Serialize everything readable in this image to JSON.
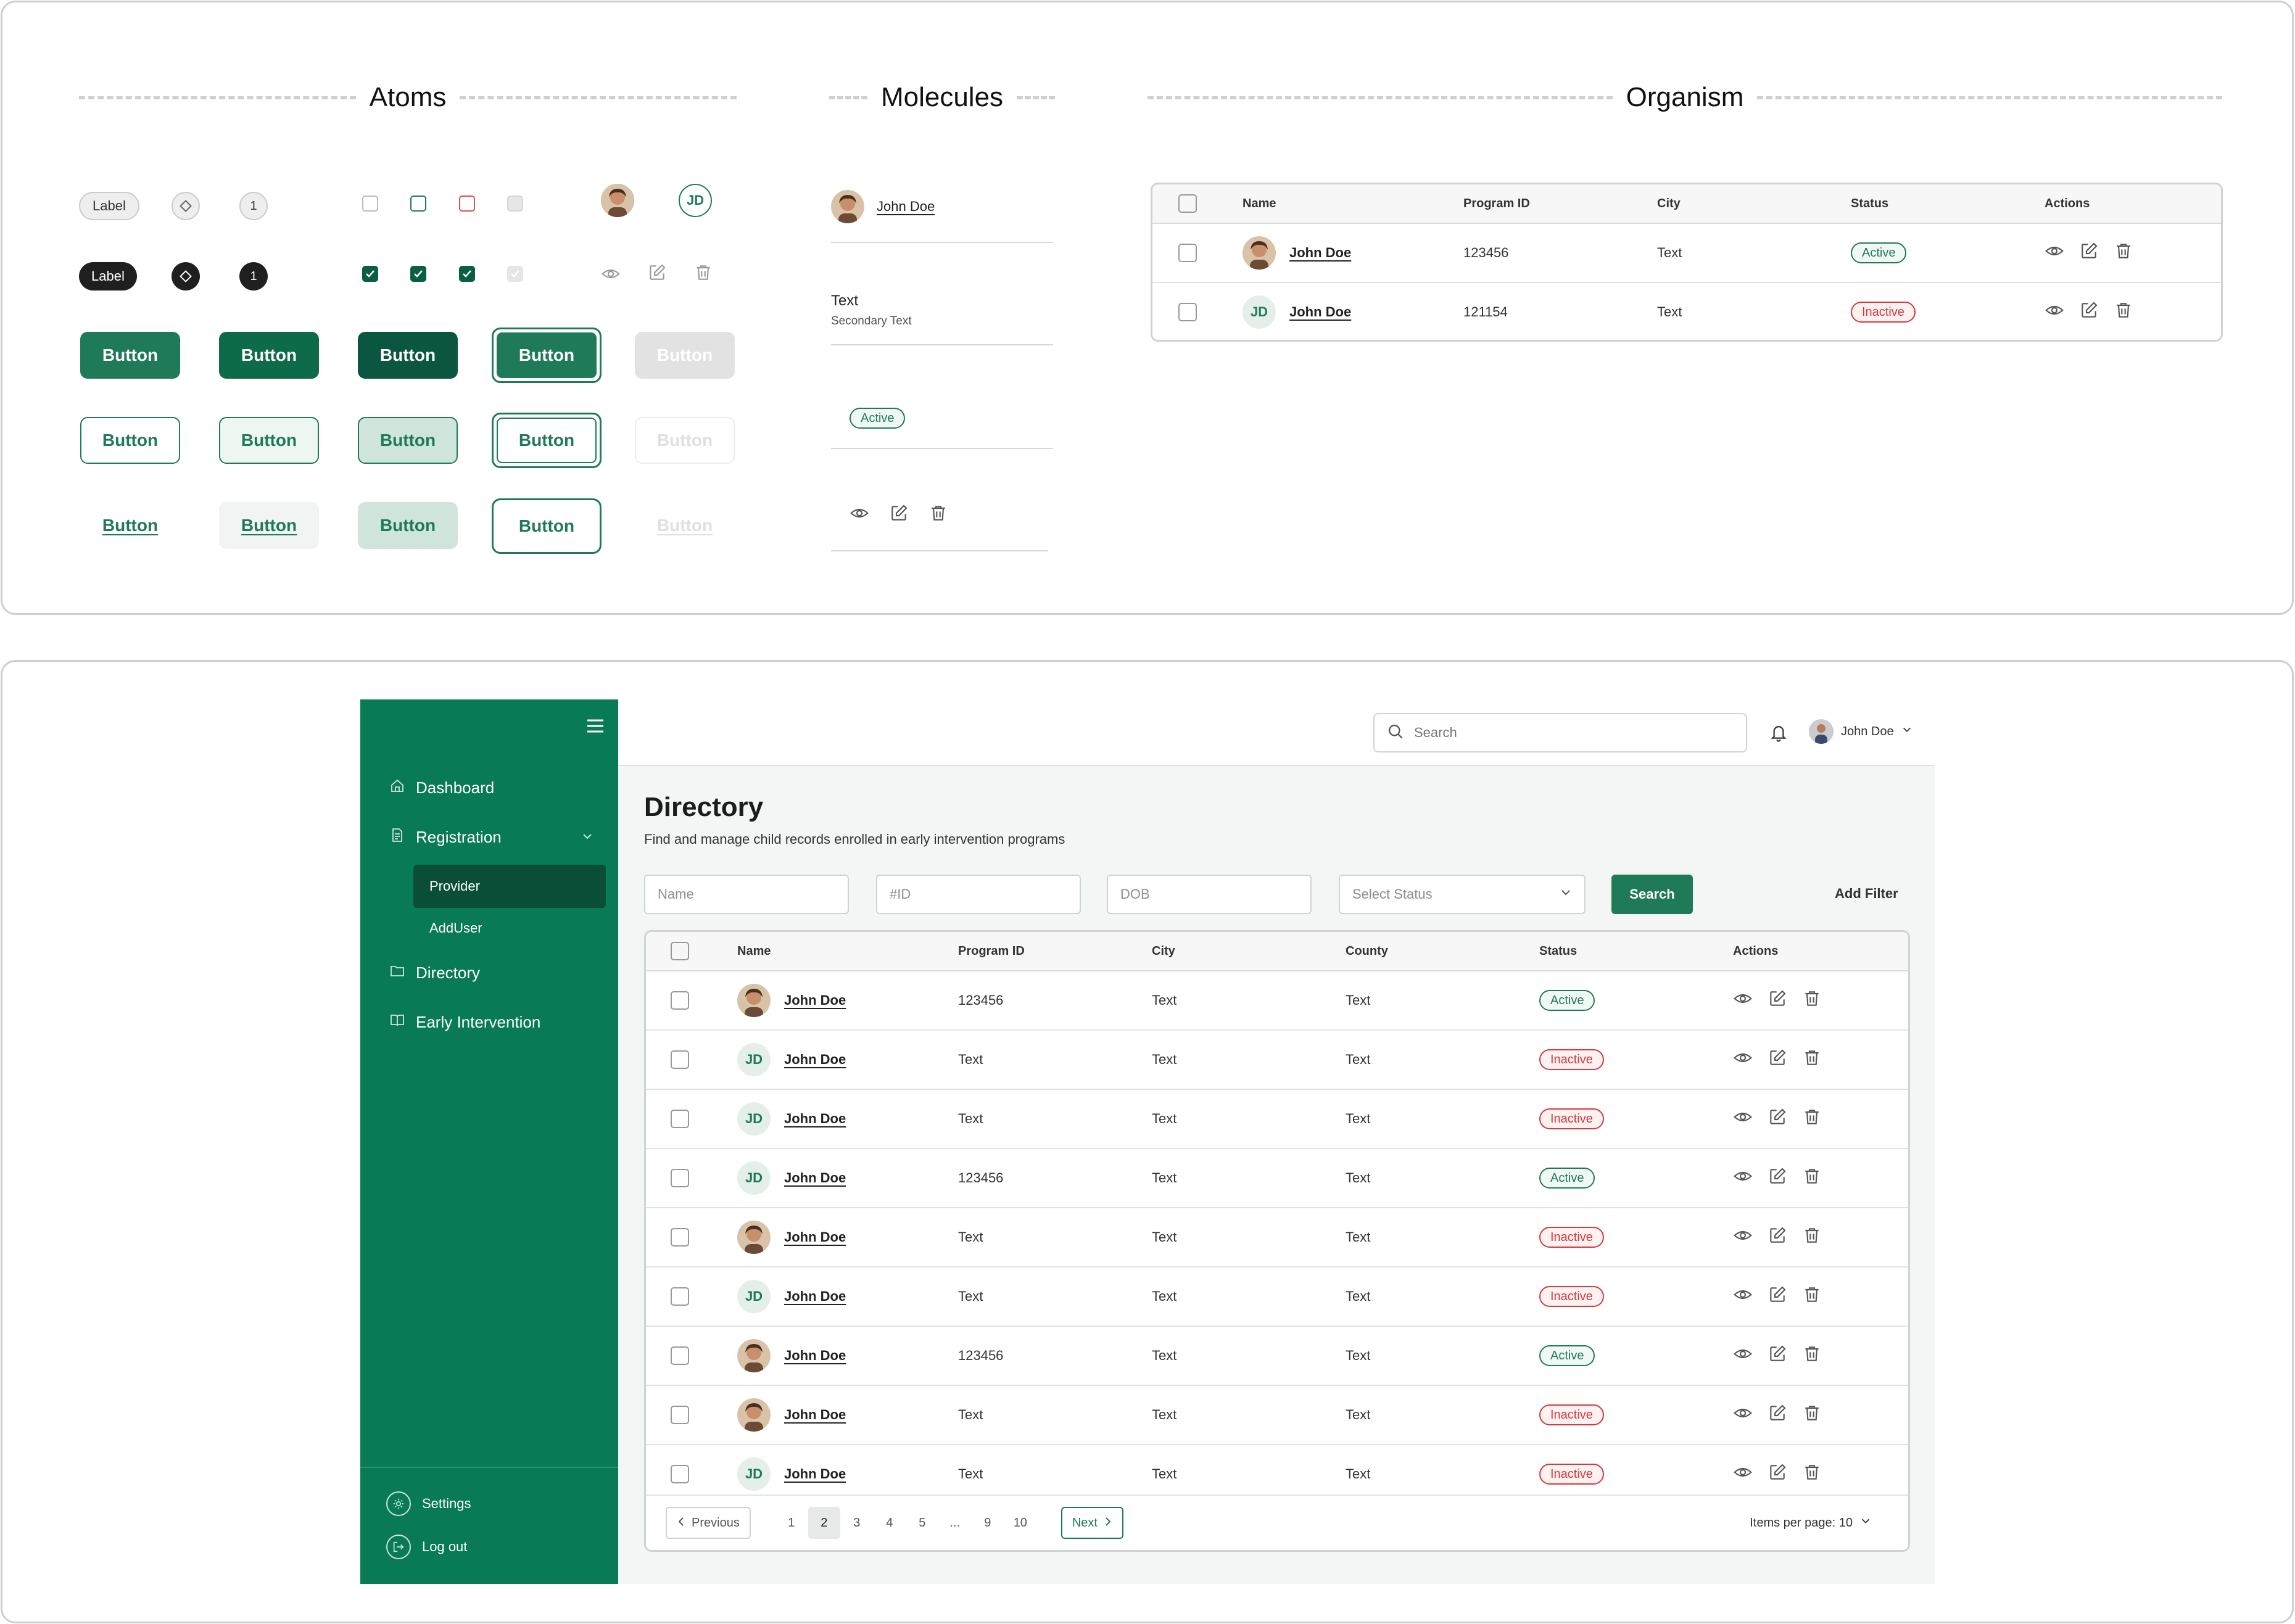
{
  "sections": {
    "atoms": "Atoms",
    "molecules": "Molecules",
    "organism": "Organism"
  },
  "atoms": {
    "label_chip": "Label",
    "counter": "1",
    "initials": "JD",
    "button": "Button"
  },
  "molecules": {
    "person_name": "John Doe",
    "text_primary": "Text",
    "text_secondary": "Secondary Text",
    "status": "Active"
  },
  "organism": {
    "columns": [
      "Name",
      "Program ID",
      "City",
      "Status",
      "Actions"
    ],
    "rows": [
      {
        "name": "John Doe",
        "avatar": "photo",
        "program_id": "123456",
        "city": "Text",
        "status": "Active",
        "status_type": "active"
      },
      {
        "name": "John Doe",
        "avatar": "JD",
        "program_id": "121154",
        "city": "Text",
        "status": "Inactive",
        "status_type": "inactive"
      }
    ]
  },
  "app": {
    "sidebar": {
      "menu_icon": "hamburger-icon",
      "items": [
        {
          "label": "Dashboard",
          "icon": "home-icon"
        },
        {
          "label": "Registration",
          "icon": "document-icon"
        },
        {
          "label": "Provider"
        },
        {
          "label": "AddUser"
        },
        {
          "label": "Directory",
          "icon": "folder-icon"
        },
        {
          "label": "Early Intervention",
          "icon": "book-icon"
        }
      ],
      "settings": "Settings",
      "logout": "Log out"
    },
    "header": {
      "search_placeholder": "Search",
      "user_name": "John Doe"
    },
    "page": {
      "title": "Directory",
      "subtitle": "Find and manage child records enrolled in early intervention programs"
    },
    "filters": {
      "name_placeholder": "Name",
      "id_placeholder": "#ID",
      "dob_placeholder": "DOB",
      "status_select": "Select Status",
      "search_button": "Search",
      "add_filter": "Add Filter"
    },
    "table": {
      "columns": [
        "Name",
        "Program ID",
        "City",
        "County",
        "Status",
        "Actions"
      ],
      "rows": [
        {
          "name": "John Doe",
          "avatar": "photo",
          "program_id": "123456",
          "city": "Text",
          "county": "Text",
          "status": "Active",
          "status_type": "active"
        },
        {
          "name": "John Doe",
          "avatar": "JD",
          "program_id": "Text",
          "city": "Text",
          "county": "Text",
          "status": "Inactive",
          "status_type": "inactive"
        },
        {
          "name": "John Doe",
          "avatar": "JD",
          "program_id": "Text",
          "city": "Text",
          "county": "Text",
          "status": "Inactive",
          "status_type": "inactive"
        },
        {
          "name": "John Doe",
          "avatar": "JD",
          "program_id": "123456",
          "city": "Text",
          "county": "Text",
          "status": "Active",
          "status_type": "active"
        },
        {
          "name": "John Doe",
          "avatar": "photo",
          "program_id": "Text",
          "city": "Text",
          "county": "Text",
          "status": "Inactive",
          "status_type": "inactive"
        },
        {
          "name": "John Doe",
          "avatar": "JD",
          "program_id": "Text",
          "city": "Text",
          "county": "Text",
          "status": "Inactive",
          "status_type": "inactive"
        },
        {
          "name": "John Doe",
          "avatar": "photo",
          "program_id": "123456",
          "city": "Text",
          "county": "Text",
          "status": "Active",
          "status_type": "active"
        },
        {
          "name": "John Doe",
          "avatar": "photo",
          "program_id": "Text",
          "city": "Text",
          "county": "Text",
          "status": "Inactive",
          "status_type": "inactive"
        },
        {
          "name": "John Doe",
          "avatar": "JD",
          "program_id": "Text",
          "city": "Text",
          "county": "Text",
          "status": "Inactive",
          "status_type": "inactive"
        }
      ]
    },
    "pagination": {
      "previous": "Previous",
      "next": "Next",
      "pages": [
        "1",
        "2",
        "3",
        "4",
        "5",
        "...",
        "9",
        "10"
      ],
      "current": "2",
      "items_per_page": "Items per page: 10"
    }
  },
  "colors": {
    "brand": "#087a55",
    "brand_dark": "#0a5f43",
    "active": "#1f7a58",
    "inactive": "#d23b3b"
  }
}
